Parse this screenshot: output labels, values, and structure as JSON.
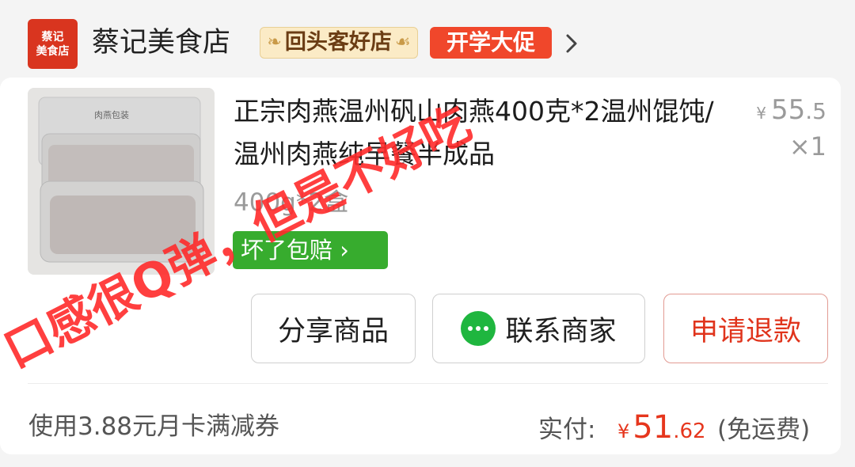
{
  "shop": {
    "logo_line1": "蔡记",
    "logo_line2": "美食店",
    "name": "蔡记美食店",
    "badge_returning": "回头客好店",
    "badge_promo": "开学大促"
  },
  "product": {
    "title": "正宗肉燕温州矾山肉燕400克*2温州馄饨/温州肉燕纯早餐半成品",
    "price_symbol": "¥",
    "price_int": "55",
    "price_dec": ".5",
    "quantity": "×1",
    "spec": "400g*2盒",
    "guarantee": "坏了包赔",
    "thumbnail_label": "肉燕包装"
  },
  "buttons": {
    "share": "分享商品",
    "contact": "联系商家",
    "refund": "申请退款"
  },
  "footer": {
    "coupon": "使用3.88元月卡满减券",
    "paid_label": "实付:",
    "paid_symbol": "¥",
    "paid_int": "51",
    "paid_dec": ".62",
    "shipping": "(免运费)"
  },
  "overlay_text": "口感很Q弹，但是不好吃",
  "colors": {
    "accent_red": "#e6361d",
    "promo_orange": "#f0472b",
    "guarantee_green": "#37ac2e",
    "wechat_green": "#1fb63f"
  }
}
